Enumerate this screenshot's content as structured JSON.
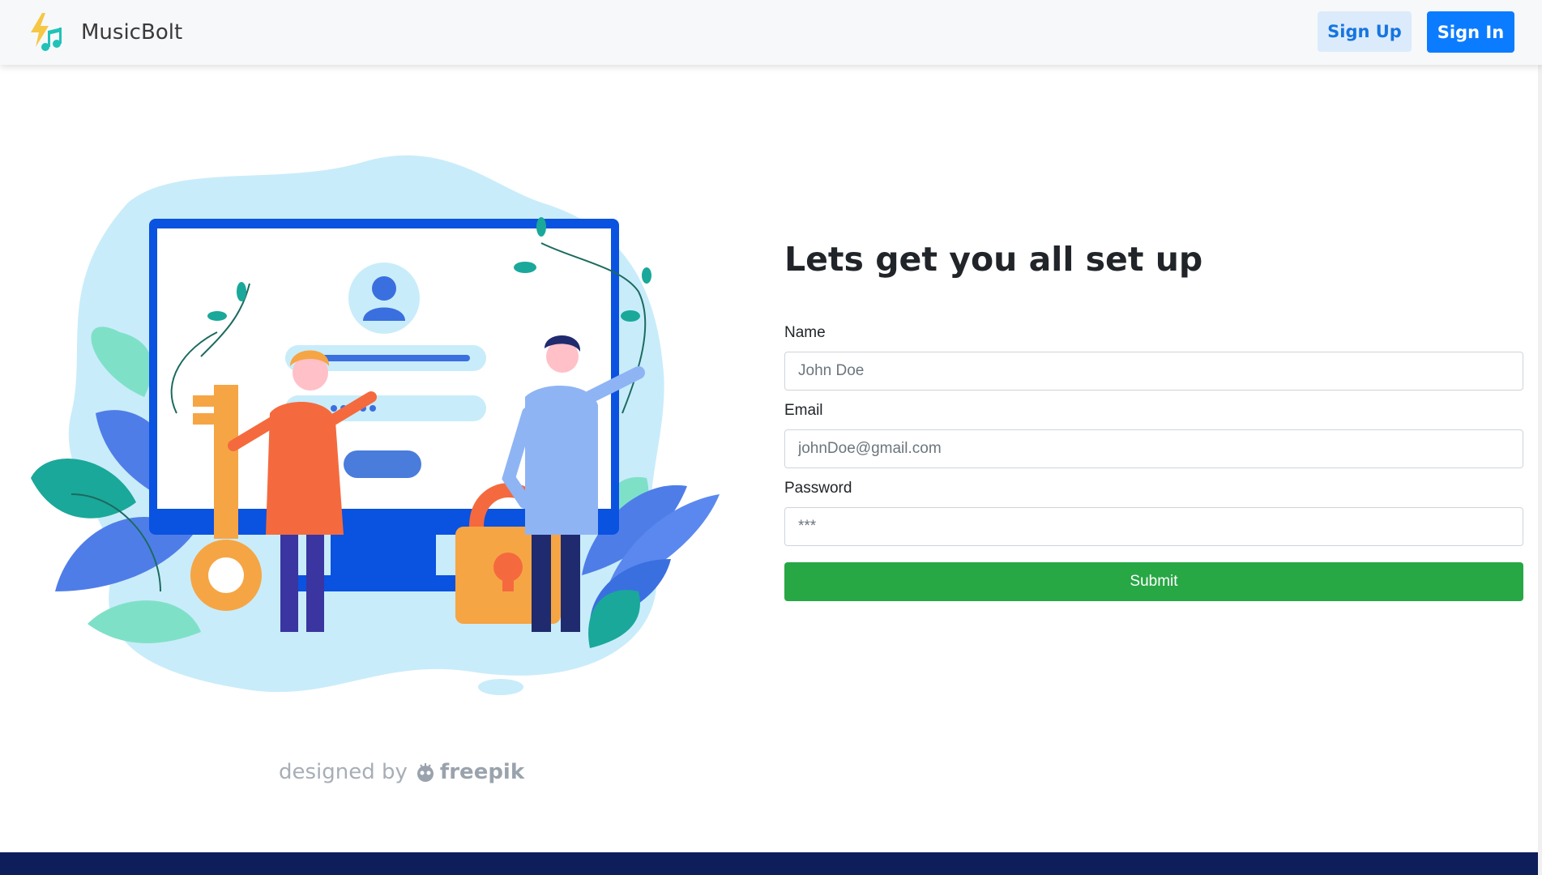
{
  "navbar": {
    "brand_name": "MusicBolt",
    "signup_label": "Sign Up",
    "signin_label": "Sign In"
  },
  "main": {
    "heading": "Lets get you all set up",
    "credit_prefix": "designed by",
    "credit_brand": "freepik"
  },
  "form": {
    "name_label": "Name",
    "name_placeholder": "John Doe",
    "email_label": "Email",
    "email_placeholder": "johnDoe@gmail.com",
    "password_label": "Password",
    "password_placeholder": "***",
    "submit_label": "Submit"
  },
  "colors": {
    "primary": "#0b7cff",
    "success": "#28a745",
    "footer": "#0e1e5b",
    "illustration_blue": "#0a52e0",
    "illustration_light": "#c9ecfa"
  }
}
